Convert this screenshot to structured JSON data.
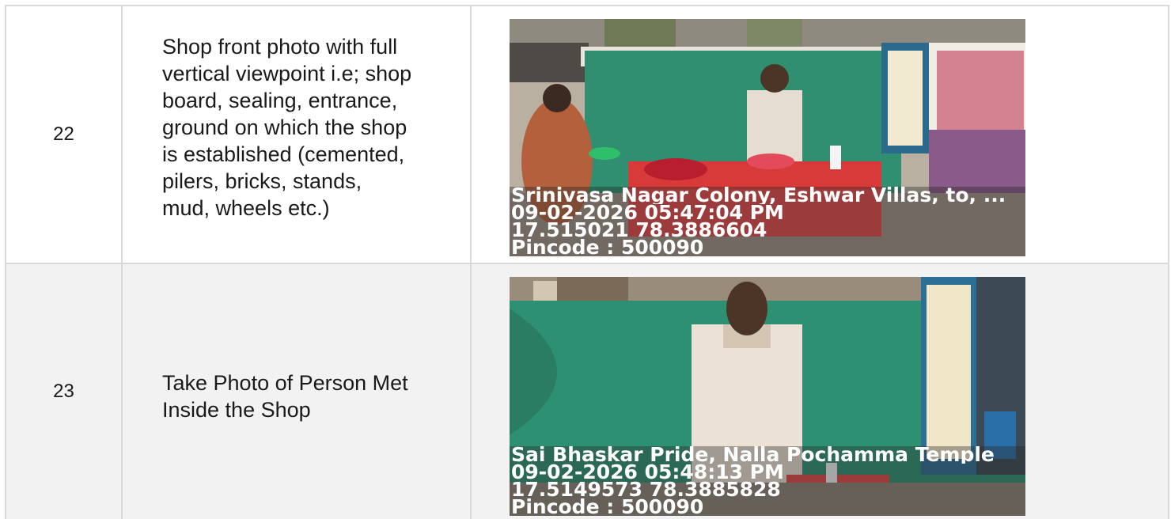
{
  "rows": [
    {
      "number": "22",
      "description": "Shop front photo with full\nvertical viewpoint i.e; shop\nboard, sealing, entrance,\nground on which the shop\nis established (cemented,\npilers, bricks, stands,\nmud, wheels etc.)",
      "photo": {
        "location": "Srinivasa Nagar Colony, Eshwar Villas, to, ...",
        "datetime": "09-02-2026 05:47:04 PM",
        "coordinates": "17.515021 78.3886604",
        "pincode": "Pincode : 500090"
      }
    },
    {
      "number": "23",
      "description": "Take Photo of Person Met\nInside the Shop",
      "photo": {
        "location": "Sai Bhaskar Pride, Nalla Pochamma Temple",
        "datetime": "09-02-2026 05:48:13 PM",
        "coordinates": "17.5149573 78.3885828",
        "pincode": "Pincode : 500090"
      }
    }
  ]
}
